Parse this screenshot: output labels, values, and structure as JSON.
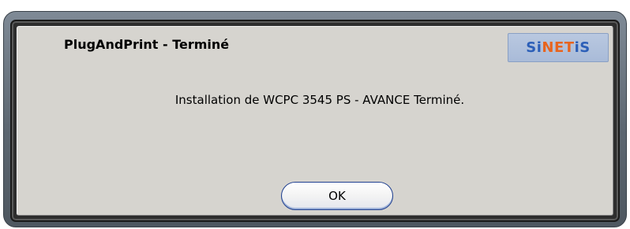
{
  "dialog": {
    "title": "PlugAndPrint - Terminé",
    "logo": {
      "part1": "Si",
      "part2": "NET",
      "part3": "iS",
      "colors": {
        "primary": "#2c5fb8",
        "accent": "#e8641e",
        "background": "#aebfda"
      }
    },
    "message": "Installation de WCPC 3545 PS - AVANCE Terminé.",
    "ok_label": "OK"
  }
}
